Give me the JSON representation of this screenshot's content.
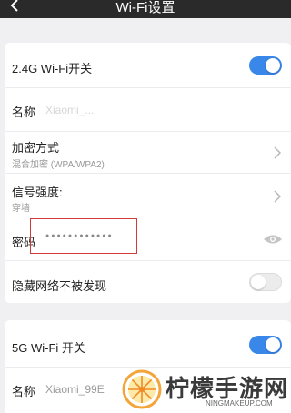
{
  "header": {
    "title": "Wi-Fi设置"
  },
  "wifi24": {
    "toggle_label": "2.4G Wi-Fi开关",
    "toggle_on": true,
    "name_label": "名称",
    "name_value": "Xiaomi_...",
    "encryption_label": "加密方式",
    "encryption_value": "混合加密 (WPA/WPA2)",
    "signal_label": "信号强度:",
    "signal_value": "穿墙",
    "password_label": "密码",
    "password_value": "●●●●●●●●●●●●",
    "hidden_label": "隐藏网络不被发现",
    "hidden_on": false
  },
  "wifi5": {
    "toggle_label": "5G Wi-Fi 开关",
    "toggle_on": true,
    "name_label": "名称",
    "name_value": "Xiaomi_99E"
  },
  "watermark": {
    "brand": "柠檬手游网",
    "url": "NINGMAKEUP.COM"
  },
  "colors": {
    "accent": "#3a87ea",
    "highlight": "#d23a3a",
    "titlebar": "#2a2a2a"
  }
}
